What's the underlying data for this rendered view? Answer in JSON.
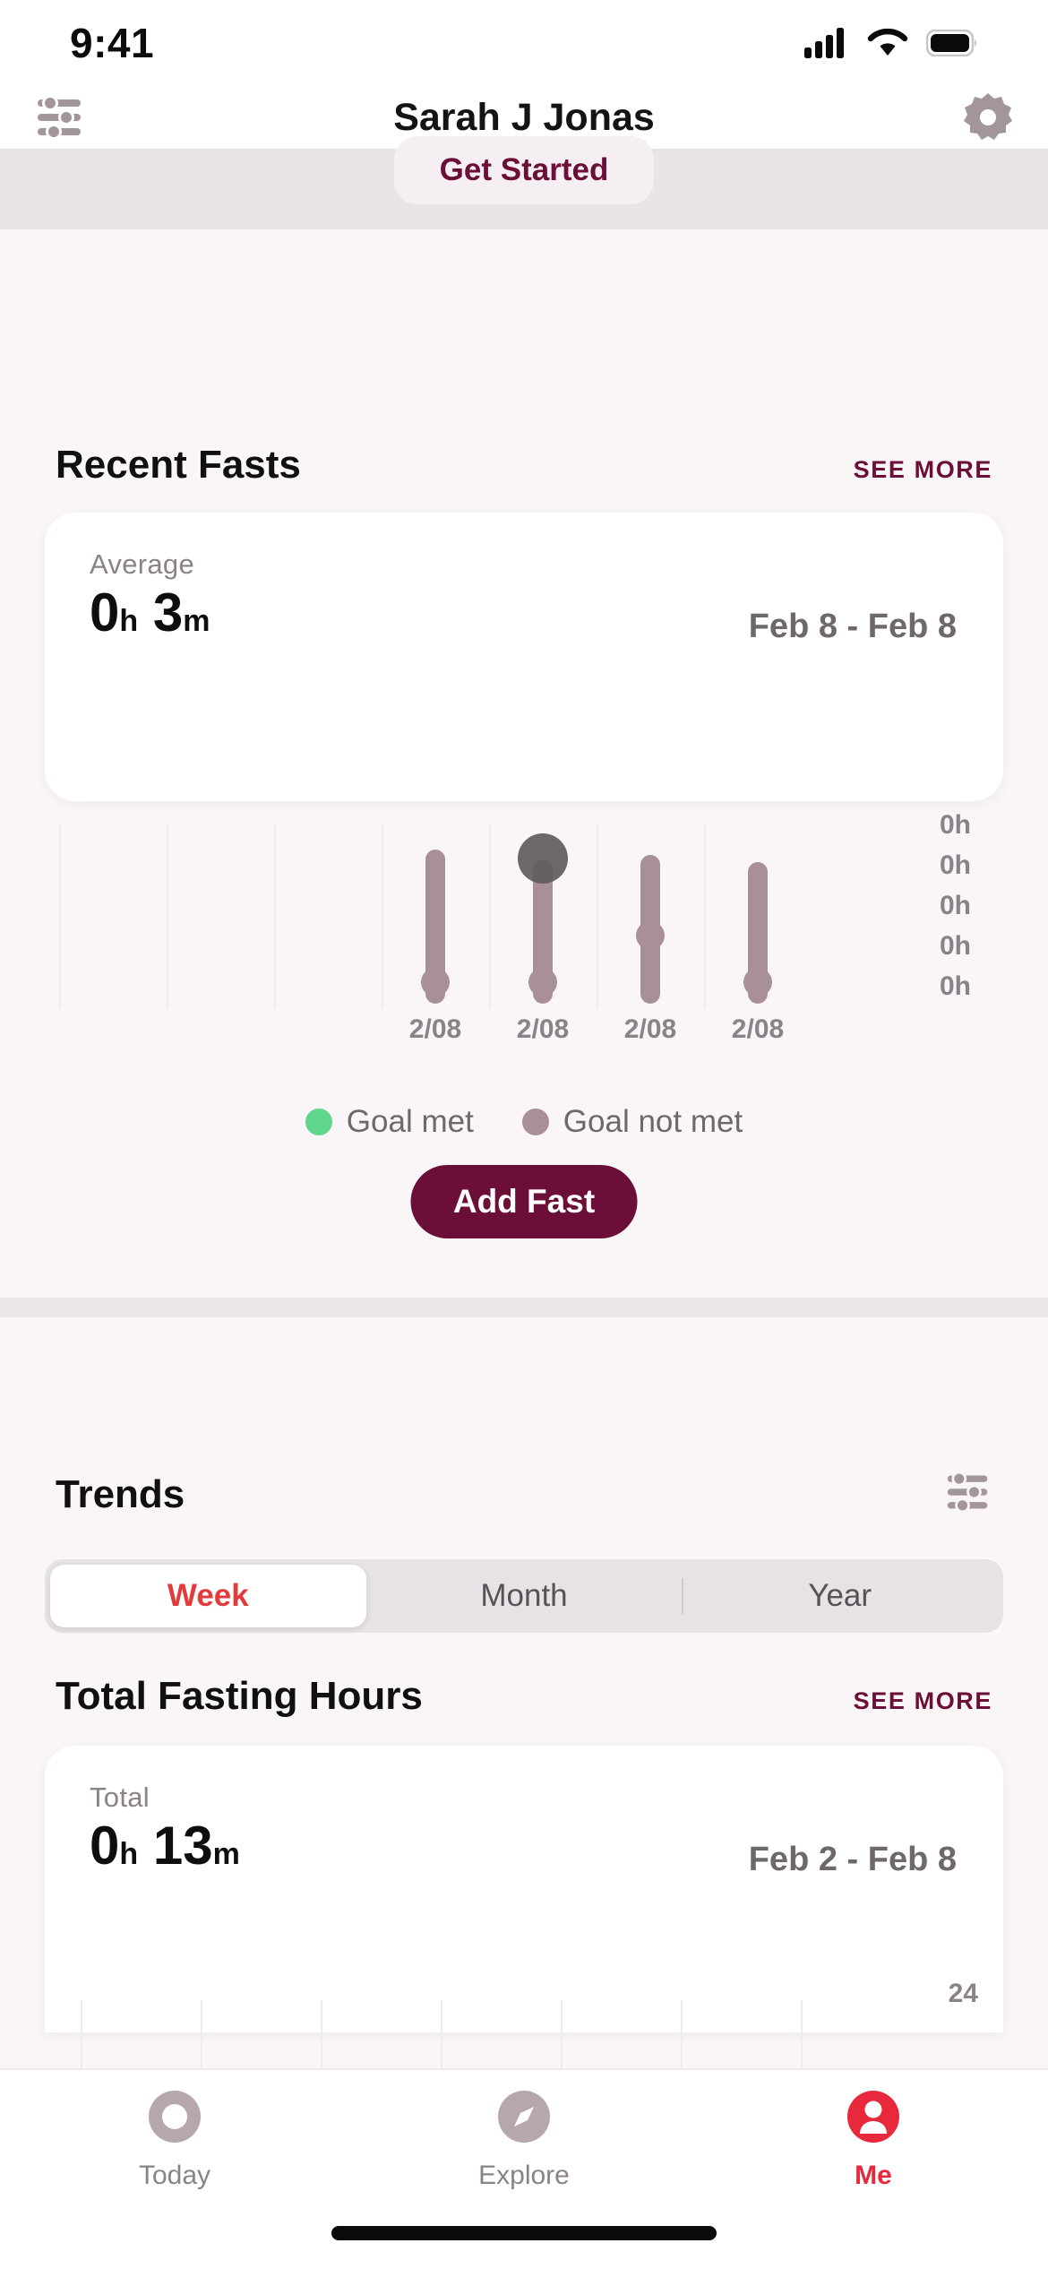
{
  "status_bar": {
    "time": "9:41",
    "cellular_icon": "cellular-signal-icon",
    "wifi_icon": "wifi-icon",
    "battery_icon": "battery-icon"
  },
  "header": {
    "title": "Sarah J Jonas",
    "left_icon": "sliders-icon",
    "right_icon": "gear-icon"
  },
  "get_started": {
    "label": "Get Started"
  },
  "recent_fasts": {
    "title": "Recent Fasts",
    "see_more": "SEE MORE",
    "stat_label": "Average",
    "stat_hours": "0",
    "stat_hours_unit": "h",
    "stat_minutes": "3",
    "stat_minutes_unit": "m",
    "date_range": "Feb 8 - Feb 8",
    "legend": [
      {
        "label": "Goal met",
        "color": "#5FD68C"
      },
      {
        "label": "Goal not met",
        "color": "#A99097"
      }
    ],
    "add_fast_label": "Add Fast"
  },
  "chart_data": {
    "type": "bar",
    "title": "Recent Fasts",
    "xlabel": "",
    "ylabel": "",
    "grid": true,
    "legend_position": "bottom",
    "categories": [
      "",
      "",
      "",
      "2/08",
      "2/08",
      "2/08",
      "2/08"
    ],
    "values": [
      null,
      null,
      null,
      0.05,
      0.05,
      0.05,
      0.05
    ],
    "ytick_labels": [
      "0h",
      "0h",
      "0h",
      "0h",
      "0h"
    ],
    "ylim": [
      0,
      0
    ],
    "series": [
      {
        "name": "Goal not met",
        "color": "#A99097",
        "values": [
          null,
          null,
          null,
          0.05,
          0.05,
          0.05,
          0.05
        ]
      }
    ],
    "annotations": [
      "selected marker on bar 5"
    ]
  },
  "trends": {
    "title": "Trends",
    "filter_icon": "sliders-icon",
    "segments": [
      {
        "label": "Week",
        "selected": true
      },
      {
        "label": "Month",
        "selected": false
      },
      {
        "label": "Year",
        "selected": false
      }
    ]
  },
  "total_fasting_hours": {
    "title": "Total Fasting Hours",
    "see_more": "SEE MORE",
    "stat_label": "Total",
    "stat_hours": "0",
    "stat_hours_unit": "h",
    "stat_minutes": "13",
    "stat_minutes_unit": "m",
    "date_range": "Feb 2 - Feb 8",
    "ytick_top": "24"
  },
  "tab_bar": {
    "tabs": [
      {
        "label": "Today",
        "icon": "circle-today-icon",
        "active": false
      },
      {
        "label": "Explore",
        "icon": "compass-icon",
        "active": false
      },
      {
        "label": "Me",
        "icon": "person-icon",
        "active": true
      }
    ]
  },
  "colors": {
    "accent_maroon": "#6B0F38",
    "accent_red": "#E8293C",
    "bar_mauve": "#A99097",
    "goal_met_green": "#5FD68C",
    "page_bg": "#FAF6F8"
  }
}
